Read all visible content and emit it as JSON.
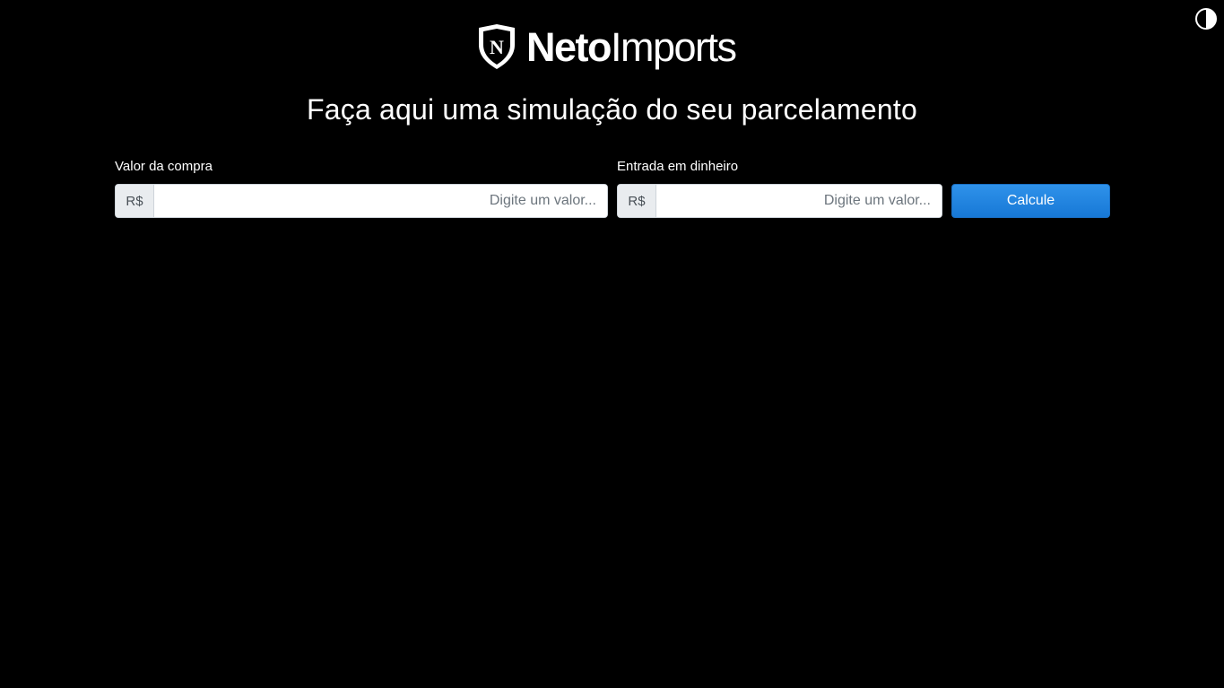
{
  "header": {
    "logo": {
      "text_bold": "Neto",
      "text_light": "Imports",
      "emblem_letter": "N",
      "icon": "shield-icon"
    },
    "contrast_toggle": {
      "icon": "contrast-icon"
    }
  },
  "main": {
    "title": "Faça aqui uma simulação do seu parcelamento",
    "form": {
      "purchase_value": {
        "label": "Valor da compra",
        "prefix": "R$",
        "value": "",
        "placeholder": "Digite um valor..."
      },
      "down_payment": {
        "label": "Entrada em dinheiro",
        "prefix": "R$",
        "value": "",
        "placeholder": "Digite um valor..."
      },
      "submit_label": "Calcule"
    }
  },
  "colors": {
    "background": "#000000",
    "text": "#ffffff",
    "button": "#1778d6",
    "prefix_background": "#e9ecef"
  }
}
